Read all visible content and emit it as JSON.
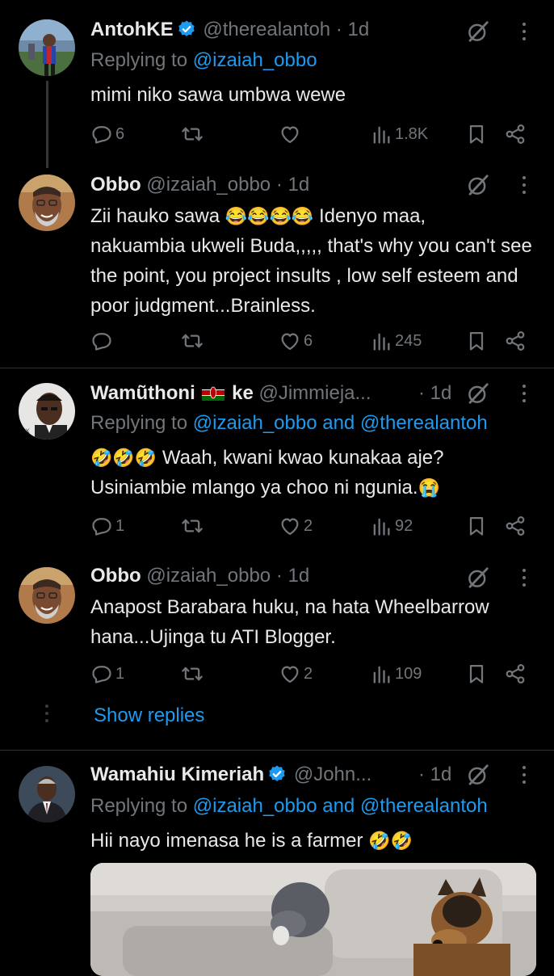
{
  "tweets": [
    {
      "name": "AntohKE",
      "verified": true,
      "handle": "@therealantoh",
      "time": "· 1d",
      "replying_prefix": "Replying to ",
      "replying_users": "@izaiah_obbo",
      "text": "mimi niko sawa umbwa wewe",
      "counts": {
        "replies": "6",
        "retweets": "",
        "likes": "",
        "views": "1.8K"
      }
    },
    {
      "name": "Obbo",
      "handle": "@izaiah_obbo",
      "time": "· 1d",
      "text_line1_a": "Zii hauko sawa ",
      "text_line1_emoji": "😂😂😂😂",
      "text_line1_b": " Idenyo maa,",
      "text_rest": "nakuambia ukweli Buda,,,,, that's why you can't see the point, you project insults , low self esteem and poor judgment...Brainless.",
      "counts": {
        "replies": "",
        "retweets": "",
        "likes": "6",
        "views": "245"
      }
    },
    {
      "name": "Wamũthoni",
      "name_suffix": "ke",
      "handle": "@Jimmieja...",
      "time": "· 1d",
      "replying_prefix": "Replying to ",
      "replying_users": "@izaiah_obbo and @therealantoh",
      "text_line1_emoji": "🤣🤣🤣",
      "text_line1": " Waah, kwani kwao kunakaa aje?",
      "text_line2": "Usiniambie mlango ya choo ni ngunia.",
      "text_line2_emoji": "😭",
      "counts": {
        "replies": "1",
        "retweets": "",
        "likes": "2",
        "views": "92"
      }
    },
    {
      "name": "Obbo",
      "handle": "@izaiah_obbo",
      "time": "· 1d",
      "text": "Anapost Barabara huku, na hata Wheelbarrow hana...Ujinga tu ATI Blogger.",
      "counts": {
        "replies": "1",
        "retweets": "",
        "likes": "2",
        "views": "109"
      }
    },
    {
      "name": "Wamahiu Kimeriah",
      "verified": true,
      "handle": "@John...",
      "time": "· 1d",
      "replying_prefix": "Replying to ",
      "replying_users": "@izaiah_obbo and @therealantoh",
      "text": "Hii nayo imenasa he is a farmer ",
      "text_emoji": "🤣🤣"
    }
  ],
  "show_replies": "Show replies",
  "colors": {
    "accent": "#1d9bf0",
    "muted": "#71767b",
    "background": "#000000",
    "divider": "#2f3336"
  },
  "icons": [
    "verified-badge-icon",
    "grok-icon",
    "more-icon",
    "reply-icon",
    "retweet-icon",
    "like-icon",
    "views-icon",
    "bookmark-icon",
    "share-icon"
  ]
}
